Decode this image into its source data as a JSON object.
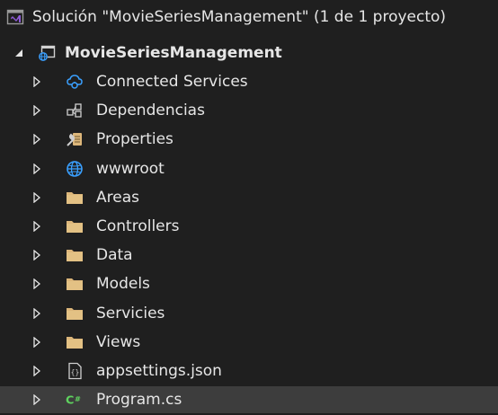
{
  "solution": {
    "label": "Solución \"MovieSeriesManagement\"  (1 de 1 proyecto)",
    "icon": "solution-icon"
  },
  "project": {
    "label": "MovieSeriesManagement",
    "icon": "web-project-icon"
  },
  "items": [
    {
      "label": "Connected Services",
      "icon": "connected-services-icon"
    },
    {
      "label": "Dependencias",
      "icon": "dependencies-icon"
    },
    {
      "label": "Properties",
      "icon": "properties-icon"
    },
    {
      "label": "wwwroot",
      "icon": "globe-icon"
    },
    {
      "label": "Areas",
      "icon": "folder-icon"
    },
    {
      "label": "Controllers",
      "icon": "folder-icon"
    },
    {
      "label": "Data",
      "icon": "folder-icon"
    },
    {
      "label": "Models",
      "icon": "folder-icon"
    },
    {
      "label": "Servicies",
      "icon": "folder-icon"
    },
    {
      "label": "Views",
      "icon": "folder-icon"
    },
    {
      "label": "appsettings.json",
      "icon": "json-file-icon"
    },
    {
      "label": "Program.cs",
      "icon": "csharp-file-icon"
    }
  ],
  "colors": {
    "background": "#1f1f1f",
    "selected": "#3d3d3d",
    "text": "#e6e6e6",
    "folder": "#dcb67a",
    "vs_purple": "#8e5bd6",
    "blue": "#3aa0ff",
    "csharp_green": "#5fd35f"
  }
}
